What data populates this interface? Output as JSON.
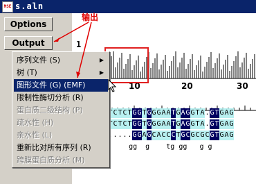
{
  "window": {
    "title": "s.aln",
    "icon_label": "MSE"
  },
  "left_panel": {
    "options_label": "Options",
    "output_label": "Output"
  },
  "alignment": {
    "row_number": "1",
    "ruler_ticks": [
      "10",
      "20",
      "30"
    ]
  },
  "menu": {
    "items": [
      {
        "label": "序列文件 (S)",
        "has_submenu": true,
        "enabled": true
      },
      {
        "label": "树 (T)",
        "has_submenu": true,
        "enabled": true
      },
      {
        "label": "图形文件 (G) (EMF)",
        "has_submenu": false,
        "enabled": true,
        "selected": true
      },
      {
        "label": "限制性酶切分析 (R)",
        "has_submenu": false,
        "enabled": true
      },
      {
        "label": "蛋白质二级结构 (P)",
        "has_submenu": false,
        "enabled": false
      },
      {
        "label": "疏水性 (H)",
        "has_submenu": false,
        "enabled": false
      },
      {
        "label": "亲水性 (L)",
        "has_submenu": false,
        "enabled": false
      },
      {
        "label": "重新比对所有序列 (R)",
        "has_submenu": false,
        "enabled": true
      },
      {
        "label": "跨膜蛋白质分析 (M)",
        "has_submenu": false,
        "enabled": false
      }
    ]
  },
  "sequences": [
    "TCTCTGGTGGGAATGAGGTA.GTGAG",
    "TCTCTGGTGGGAATGAGGTA.GTGAG",
    ".....GGAGCACCCTGCGCGCGTGAG"
  ],
  "consensus": "     gg  g    tg gg   g g",
  "annotation": {
    "text": "输出"
  },
  "colors": {
    "title_bg": "#0a246a",
    "highlight": "#b8f0f0",
    "dark": "#000060",
    "annotation": "#e00000"
  }
}
